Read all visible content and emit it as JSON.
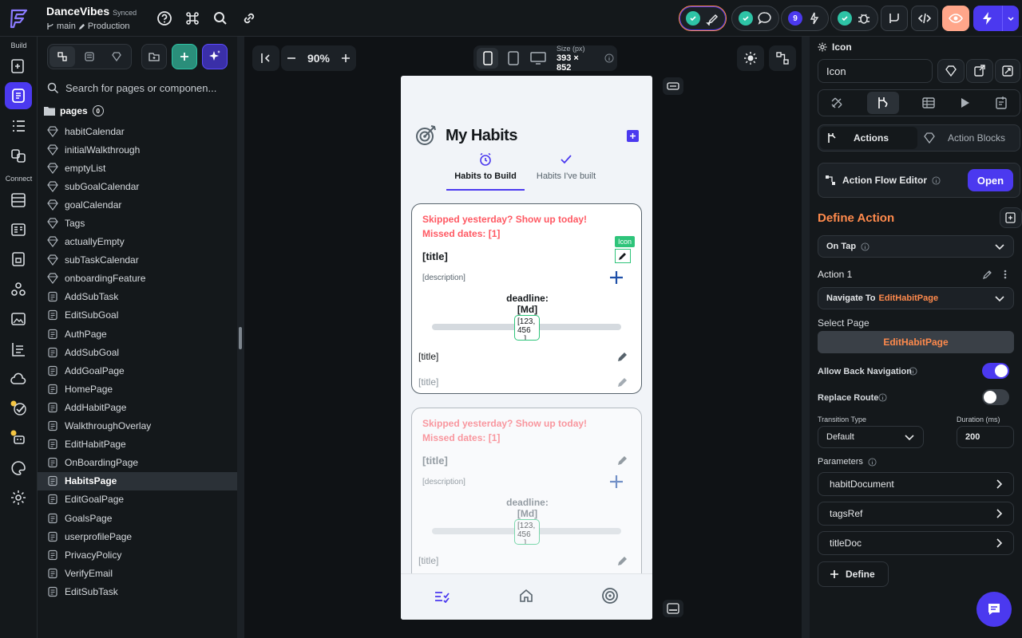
{
  "project": {
    "name": "DanceVibes",
    "sync_status": "Synced",
    "branch": "main",
    "environment": "Production"
  },
  "rail": {
    "build_label": "Build",
    "connect_label": "Connect"
  },
  "sidebar": {
    "search_placeholder": "Search for pages or componen...",
    "pages_label": "pages",
    "pages_count": "0",
    "pages": [
      {
        "name": "habitCalendar",
        "type": "component"
      },
      {
        "name": "initialWalkthrough",
        "type": "component"
      },
      {
        "name": "emptyList",
        "type": "component"
      },
      {
        "name": "subGoalCalendar",
        "type": "component"
      },
      {
        "name": "goalCalendar",
        "type": "component"
      },
      {
        "name": "Tags",
        "type": "component"
      },
      {
        "name": "actuallyEmpty",
        "type": "component"
      },
      {
        "name": "subTaskCalendar",
        "type": "component"
      },
      {
        "name": "onboardingFeature",
        "type": "component"
      },
      {
        "name": "AddSubTask",
        "type": "page"
      },
      {
        "name": "EditSubGoal",
        "type": "page"
      },
      {
        "name": "AuthPage",
        "type": "page"
      },
      {
        "name": "AddSubGoal",
        "type": "page"
      },
      {
        "name": "AddGoalPage",
        "type": "page"
      },
      {
        "name": "HomePage",
        "type": "page"
      },
      {
        "name": "AddHabitPage",
        "type": "page"
      },
      {
        "name": "WalkthroughOverlay",
        "type": "page"
      },
      {
        "name": "EditHabitPage",
        "type": "page"
      },
      {
        "name": "OnBoardingPage",
        "type": "page"
      },
      {
        "name": "HabitsPage",
        "type": "page",
        "selected": true
      },
      {
        "name": "EditGoalPage",
        "type": "page"
      },
      {
        "name": "GoalsPage",
        "type": "page"
      },
      {
        "name": "userprofilePage",
        "type": "page"
      },
      {
        "name": "PrivacyPolicy",
        "type": "page"
      },
      {
        "name": "VerifyEmail",
        "type": "page"
      },
      {
        "name": "EditSubTask",
        "type": "page"
      }
    ]
  },
  "toolbar": {
    "zoom": "90%",
    "size_label": "Size (px)",
    "size_value": "393 × 852",
    "issues_count": "9"
  },
  "phone": {
    "header_title": "My Habits",
    "tabs": [
      {
        "label": "Habits to Build"
      },
      {
        "label": "Habits I've built"
      }
    ],
    "cards": [
      {
        "warning": "Skipped yesterday? Show up today!",
        "missed": "Missed dates: [1]",
        "title": "[title]",
        "description": "[description]",
        "deadline_label": "deadline:",
        "deadline_value": "[Md]",
        "slider_value": "[123, 456 ...]",
        "row1": "[title]",
        "row2": "[title]"
      },
      {
        "warning": "Skipped yesterday? Show up today!",
        "missed": "Missed dates: [1]",
        "title": "[title]",
        "description": "[description]",
        "deadline_label": "deadline:",
        "deadline_value": "[Md]",
        "slider_value": "[123, 456 ...]",
        "row1": "[title]"
      }
    ],
    "selected_tag": "Icon"
  },
  "properties": {
    "widget_type": "Icon",
    "widget_name": "Icon",
    "tabs": {
      "actions": "Actions",
      "action_blocks": "Action Blocks"
    },
    "flow_editor": {
      "label": "Action Flow Editor",
      "button": "Open"
    },
    "define_action": "Define Action",
    "trigger": "On Tap",
    "action_name": "Action 1",
    "action_type_prefix": "Navigate To",
    "action_type_target": "EditHabitPage",
    "select_page_label": "Select Page",
    "select_page_value": "EditHabitPage",
    "allow_back_label": "Allow Back Navigation",
    "allow_back": true,
    "replace_route_label": "Replace Route",
    "replace_route": false,
    "transition_label": "Transition Type",
    "transition_value": "Default",
    "duration_label": "Duration (ms)",
    "duration_value": "200",
    "parameters_label": "Parameters",
    "parameters": [
      "habitDocument",
      "tagsRef",
      "titleDoc"
    ],
    "define_button": "Define"
  },
  "colors": {
    "brand": "#4b39ef",
    "accent_orange": "#ff8a4c",
    "warning_red": "#ff5963",
    "success": "#2ec4a6",
    "toggle_on": "#4b39ef"
  }
}
